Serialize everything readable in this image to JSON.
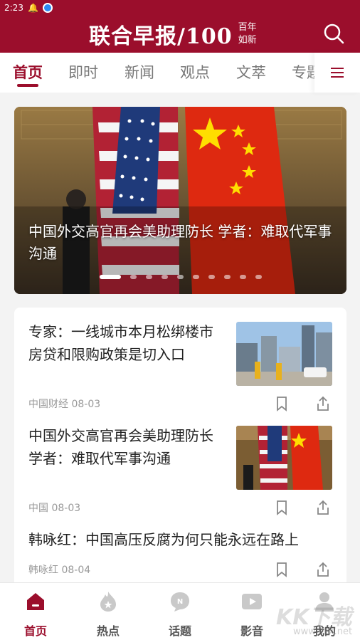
{
  "status": {
    "time": "2:23"
  },
  "header": {
    "logo_text": "联合早报/100",
    "logo_sub_top": "百年",
    "logo_sub_bottom": "如新",
    "search_icon": "search-icon"
  },
  "tabs": [
    {
      "label": "首页"
    },
    {
      "label": "即时"
    },
    {
      "label": "新闻"
    },
    {
      "label": "观点"
    },
    {
      "label": "文萃"
    },
    {
      "label": "专题"
    }
  ],
  "hero": {
    "caption": "中国外交高官再会美助理防长 学者：难取代军事沟通",
    "slides": 11,
    "active_slide": 1
  },
  "articles": [
    {
      "title": "专家：一线城市本月松绑楼市 房贷和限购政策是切入口",
      "source": "中国财经",
      "date": "08-03"
    },
    {
      "title": "中国外交高官再会美助理防长 学者：难取代军事沟通",
      "source": "中国",
      "date": "08-03"
    },
    {
      "title": "韩咏红：中国高压反腐为何只能永远在路上",
      "source": "韩咏红",
      "date": "08-04"
    }
  ],
  "bottom_nav": [
    {
      "label": "首页"
    },
    {
      "label": "热点"
    },
    {
      "label": "话题"
    },
    {
      "label": "影音"
    },
    {
      "label": "我的"
    }
  ],
  "watermark": {
    "text": "KK下载",
    "sub": "www.kkx.net"
  },
  "colors": {
    "brand": "#9b0e2c",
    "inactive": "#777777",
    "meta": "#999999"
  }
}
